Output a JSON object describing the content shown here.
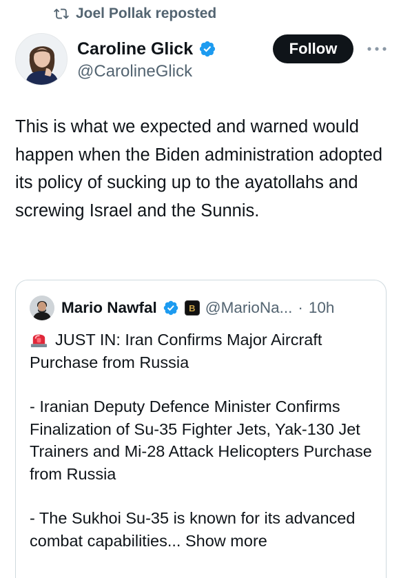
{
  "repost": {
    "icon": "repost-icon",
    "text": "Joel Pollak reposted"
  },
  "author": {
    "display_name": "Caroline Glick",
    "handle": "@CarolineGlick",
    "verified": true,
    "avatar_icon": "profile-photo"
  },
  "actions": {
    "follow_label": "Follow",
    "more_icon": "more-dots-icon"
  },
  "tweet": {
    "text": "This is what we expected and warned would happen when the Biden administration adopted its policy of sucking up to the ayatollahs and screwing Israel and the Sunnis."
  },
  "quote": {
    "display_name": "Mario Nawfal",
    "verified": true,
    "affiliate_badge": "B",
    "handle": "@MarioNa...",
    "separator": "·",
    "time": "10h",
    "headline": "JUST IN: Iran Confirms Major Aircraft Purchase from Russia",
    "paragraph_1": "- Iranian Deputy Defence Minister Confirms Finalization of Su-35 Fighter Jets, Yak-130 Jet Trainers and Mi-28 Attack Helicopters Purchase from Russia",
    "paragraph_2": "- The Sukhoi Su-35 is known for its advanced combat capabilities...",
    "show_more": "Show more"
  },
  "colors": {
    "text_primary": "#0f1419",
    "text_secondary": "#536471",
    "verified_blue": "#1d9bf0",
    "follow_bg": "#0f1419",
    "border": "#cfd9de"
  }
}
